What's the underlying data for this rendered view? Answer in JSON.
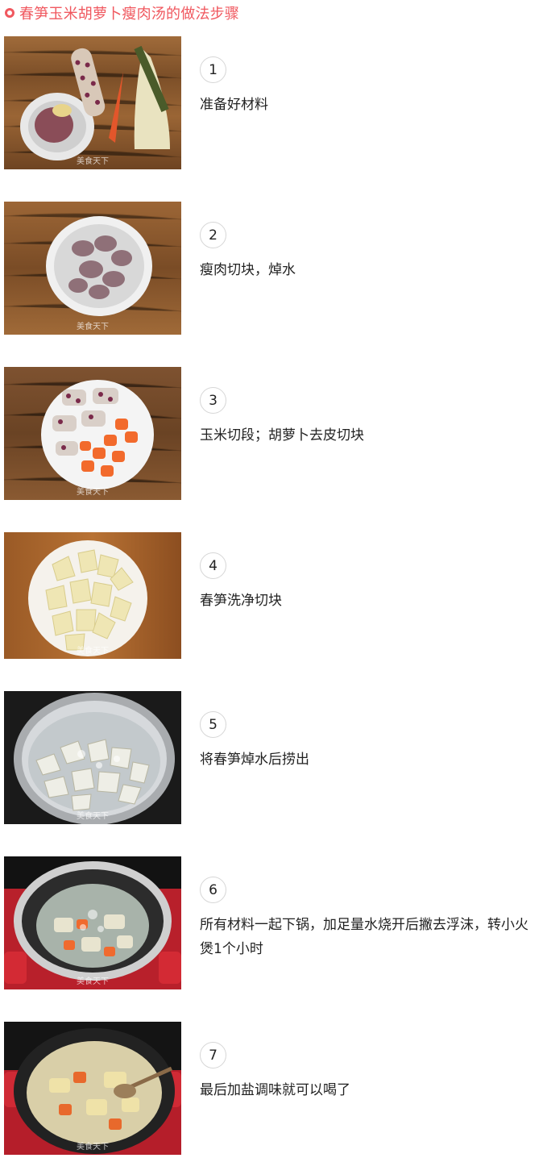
{
  "title": "春笋玉米胡萝卜瘦肉汤的做法步骤",
  "watermark": "美食天下",
  "colors": {
    "accent": "#f0585f",
    "wood": "#8b5a2b",
    "bowl": "#f2f2f2",
    "carrot": "#f2622e",
    "bamboo": "#efe5b0",
    "pot_red": "#c81e2a"
  },
  "steps": [
    {
      "number": "1",
      "text": "准备好材料",
      "photo": "ingredients on wooden table"
    },
    {
      "number": "2",
      "text": "瘦肉切块，焯水",
      "photo": "bowl of pork chunks"
    },
    {
      "number": "3",
      "text": "玉米切段；胡萝卜去皮切块",
      "photo": "plate of corn and carrot pieces"
    },
    {
      "number": "4",
      "text": "春笋洗净切块",
      "photo": "plate of cut bamboo shoots"
    },
    {
      "number": "5",
      "text": "将春笋焯水后捞出",
      "photo": "bamboo shoots boiling in steel pot"
    },
    {
      "number": "6",
      "text": "所有材料一起下锅，加足量水烧开后撇去浮沫，转小火煲1个小时",
      "photo": "soup in red pot"
    },
    {
      "number": "7",
      "text": "最后加盐调味就可以喝了",
      "photo": "finished soup in red pot"
    }
  ]
}
